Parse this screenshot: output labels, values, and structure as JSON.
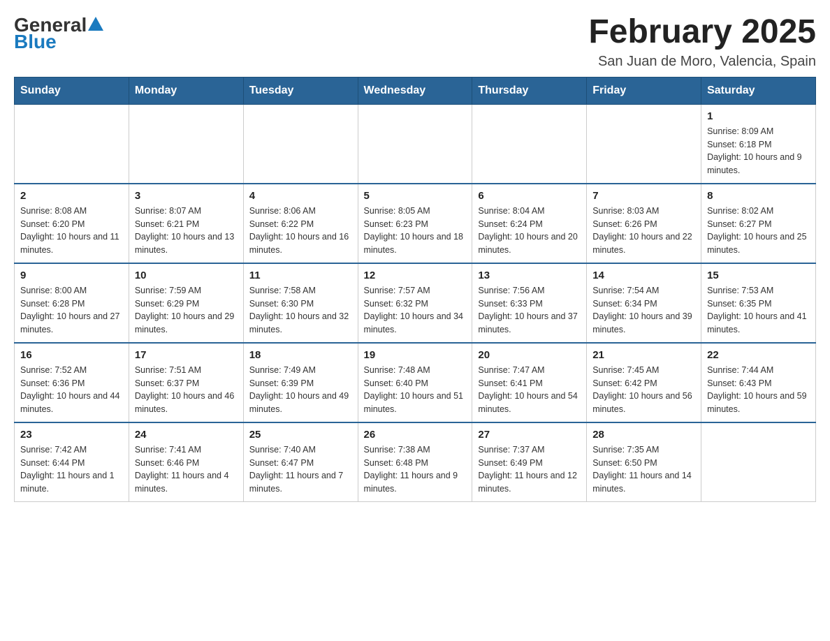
{
  "header": {
    "logo": {
      "general": "General",
      "blue": "Blue"
    },
    "title": "February 2025",
    "location": "San Juan de Moro, Valencia, Spain"
  },
  "weekdays": [
    "Sunday",
    "Monday",
    "Tuesday",
    "Wednesday",
    "Thursday",
    "Friday",
    "Saturday"
  ],
  "weeks": [
    [
      {
        "day": "",
        "info": ""
      },
      {
        "day": "",
        "info": ""
      },
      {
        "day": "",
        "info": ""
      },
      {
        "day": "",
        "info": ""
      },
      {
        "day": "",
        "info": ""
      },
      {
        "day": "",
        "info": ""
      },
      {
        "day": "1",
        "info": "Sunrise: 8:09 AM\nSunset: 6:18 PM\nDaylight: 10 hours and 9 minutes."
      }
    ],
    [
      {
        "day": "2",
        "info": "Sunrise: 8:08 AM\nSunset: 6:20 PM\nDaylight: 10 hours and 11 minutes."
      },
      {
        "day": "3",
        "info": "Sunrise: 8:07 AM\nSunset: 6:21 PM\nDaylight: 10 hours and 13 minutes."
      },
      {
        "day": "4",
        "info": "Sunrise: 8:06 AM\nSunset: 6:22 PM\nDaylight: 10 hours and 16 minutes."
      },
      {
        "day": "5",
        "info": "Sunrise: 8:05 AM\nSunset: 6:23 PM\nDaylight: 10 hours and 18 minutes."
      },
      {
        "day": "6",
        "info": "Sunrise: 8:04 AM\nSunset: 6:24 PM\nDaylight: 10 hours and 20 minutes."
      },
      {
        "day": "7",
        "info": "Sunrise: 8:03 AM\nSunset: 6:26 PM\nDaylight: 10 hours and 22 minutes."
      },
      {
        "day": "8",
        "info": "Sunrise: 8:02 AM\nSunset: 6:27 PM\nDaylight: 10 hours and 25 minutes."
      }
    ],
    [
      {
        "day": "9",
        "info": "Sunrise: 8:00 AM\nSunset: 6:28 PM\nDaylight: 10 hours and 27 minutes."
      },
      {
        "day": "10",
        "info": "Sunrise: 7:59 AM\nSunset: 6:29 PM\nDaylight: 10 hours and 29 minutes."
      },
      {
        "day": "11",
        "info": "Sunrise: 7:58 AM\nSunset: 6:30 PM\nDaylight: 10 hours and 32 minutes."
      },
      {
        "day": "12",
        "info": "Sunrise: 7:57 AM\nSunset: 6:32 PM\nDaylight: 10 hours and 34 minutes."
      },
      {
        "day": "13",
        "info": "Sunrise: 7:56 AM\nSunset: 6:33 PM\nDaylight: 10 hours and 37 minutes."
      },
      {
        "day": "14",
        "info": "Sunrise: 7:54 AM\nSunset: 6:34 PM\nDaylight: 10 hours and 39 minutes."
      },
      {
        "day": "15",
        "info": "Sunrise: 7:53 AM\nSunset: 6:35 PM\nDaylight: 10 hours and 41 minutes."
      }
    ],
    [
      {
        "day": "16",
        "info": "Sunrise: 7:52 AM\nSunset: 6:36 PM\nDaylight: 10 hours and 44 minutes."
      },
      {
        "day": "17",
        "info": "Sunrise: 7:51 AM\nSunset: 6:37 PM\nDaylight: 10 hours and 46 minutes."
      },
      {
        "day": "18",
        "info": "Sunrise: 7:49 AM\nSunset: 6:39 PM\nDaylight: 10 hours and 49 minutes."
      },
      {
        "day": "19",
        "info": "Sunrise: 7:48 AM\nSunset: 6:40 PM\nDaylight: 10 hours and 51 minutes."
      },
      {
        "day": "20",
        "info": "Sunrise: 7:47 AM\nSunset: 6:41 PM\nDaylight: 10 hours and 54 minutes."
      },
      {
        "day": "21",
        "info": "Sunrise: 7:45 AM\nSunset: 6:42 PM\nDaylight: 10 hours and 56 minutes."
      },
      {
        "day": "22",
        "info": "Sunrise: 7:44 AM\nSunset: 6:43 PM\nDaylight: 10 hours and 59 minutes."
      }
    ],
    [
      {
        "day": "23",
        "info": "Sunrise: 7:42 AM\nSunset: 6:44 PM\nDaylight: 11 hours and 1 minute."
      },
      {
        "day": "24",
        "info": "Sunrise: 7:41 AM\nSunset: 6:46 PM\nDaylight: 11 hours and 4 minutes."
      },
      {
        "day": "25",
        "info": "Sunrise: 7:40 AM\nSunset: 6:47 PM\nDaylight: 11 hours and 7 minutes."
      },
      {
        "day": "26",
        "info": "Sunrise: 7:38 AM\nSunset: 6:48 PM\nDaylight: 11 hours and 9 minutes."
      },
      {
        "day": "27",
        "info": "Sunrise: 7:37 AM\nSunset: 6:49 PM\nDaylight: 11 hours and 12 minutes."
      },
      {
        "day": "28",
        "info": "Sunrise: 7:35 AM\nSunset: 6:50 PM\nDaylight: 11 hours and 14 minutes."
      },
      {
        "day": "",
        "info": ""
      }
    ]
  ]
}
